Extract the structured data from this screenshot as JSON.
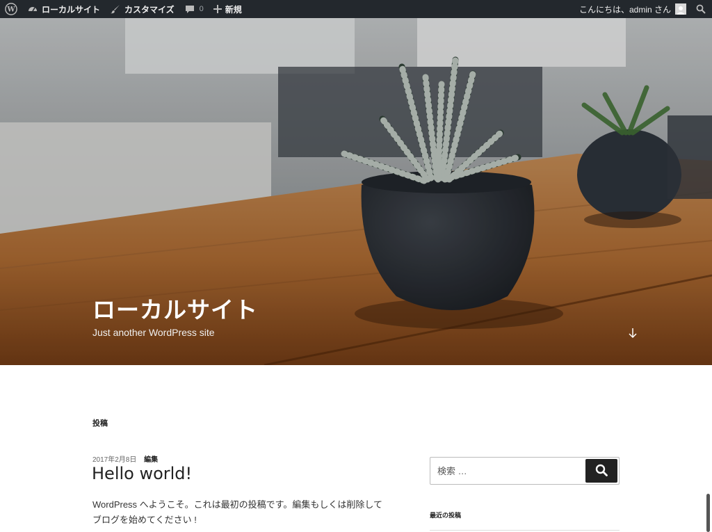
{
  "admin_bar": {
    "site_name": "ローカルサイト",
    "customize": "カスタマイズ",
    "comments_count": "0",
    "new_label": "新規",
    "greeting": "こんにちは、admin さん"
  },
  "header": {
    "site_title": "ローカルサイト",
    "site_description": "Just another WordPress site"
  },
  "main": {
    "page_heading": "投稿",
    "post": {
      "date": "2017年2月8日",
      "edit_label": "編集",
      "title": "Hello world!",
      "excerpt_line1": "WordPress へようこそ。これは最初の投稿です。編集もしくは削除して",
      "excerpt_line2": "ブログを始めてください !"
    }
  },
  "sidebar": {
    "search_placeholder": "検索 …",
    "recent_posts_title": "最近の投稿"
  },
  "colors": {
    "admin_bar_bg": "#23282d",
    "search_button_bg": "#222222"
  }
}
